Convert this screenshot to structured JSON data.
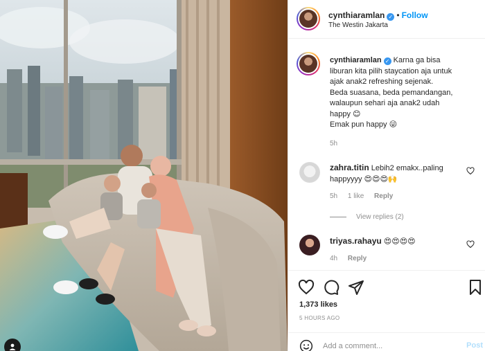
{
  "post": {
    "username": "cynthiaramlan",
    "follow_label": "Follow",
    "separator": "•",
    "location": "The Westin Jakarta",
    "verified_mark": "✓",
    "caption_lines": [
      "Karna ga bisa",
      "liburan kita pilih staycation aja untuk",
      "ajak anak2 refreshing sejenak.",
      "Beda suasana, beda pemandangan,",
      "walaupun sehari aja anak2 udah",
      "happy 😊",
      "Emak pun happy 😜"
    ],
    "caption_time": "5h",
    "likes": "1,373 likes",
    "timestamp": "5 HOURS AGO"
  },
  "comments": [
    {
      "username": "zahra.titin",
      "text": "Lebih2 emakx..paling happyyyy 😍😍😍🙌",
      "time": "5h",
      "likes": "1 like",
      "reply_label": "Reply",
      "view_replies": "View replies (2)"
    },
    {
      "username": "triyas.rahayu",
      "text": "😍😍😍😍",
      "time": "4h",
      "reply_label": "Reply"
    }
  ],
  "add_comment": {
    "placeholder": "Add a comment...",
    "post_label": "Post"
  },
  "icons": {
    "like": "heart-icon",
    "comment": "comment-icon",
    "share": "send-icon",
    "save": "bookmark-icon",
    "emoji": "emoji-icon",
    "tag": "user-tag-icon"
  },
  "colors": {
    "accent": "#0095f6",
    "verified": "#3897f0",
    "muted": "#8e8e8e",
    "post_disabled": "#b2dffc"
  }
}
